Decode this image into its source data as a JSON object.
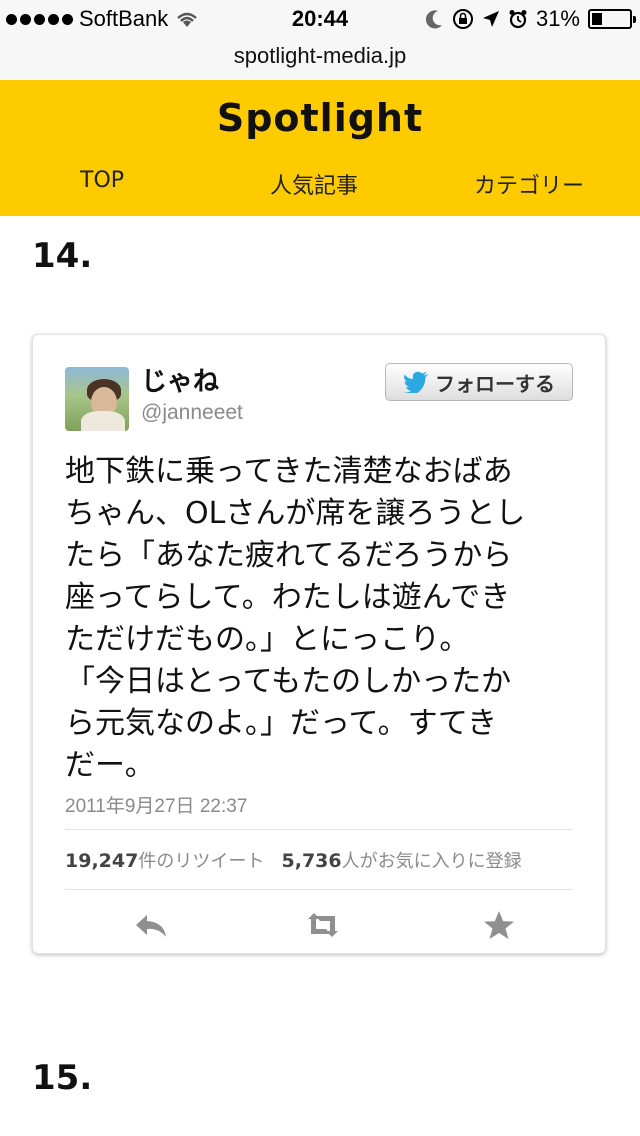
{
  "status_bar": {
    "carrier": "SoftBank",
    "time": "20:44",
    "battery_pct": "31%",
    "signal_bars": 5
  },
  "browser": {
    "url": "spotlight-media.jp"
  },
  "site": {
    "logo": "Spotlight",
    "nav": [
      "TOP",
      "人気記事",
      "カテゴリー"
    ],
    "brand_color": "#fecb00"
  },
  "article": {
    "item_numbers": [
      "14.",
      "15."
    ],
    "tweet": {
      "display_name": "じゃね",
      "handle": "@janneeet",
      "follow_label": "フォローする",
      "text_lines": [
        "地下鉄に乗ってきた清楚なおばあ",
        "ちゃん、OLさんが席を譲ろうとし",
        "たら「あなた疲れてるだろうから",
        "座ってらして。わたしは遊んでき",
        "ただけだもの。」とにっこり。",
        "「今日はとってもたのしかったか",
        "ら元気なのよ。」だって。すてき",
        "だー。"
      ],
      "date": "2011年9月27日 22:37",
      "retweets": {
        "count": "19,247",
        "label": "件のリツイート"
      },
      "favorites": {
        "count": "5,736",
        "label": "人がお気に入りに登録"
      },
      "actions": [
        "reply-icon",
        "retweet-icon",
        "favorite-icon"
      ]
    }
  }
}
